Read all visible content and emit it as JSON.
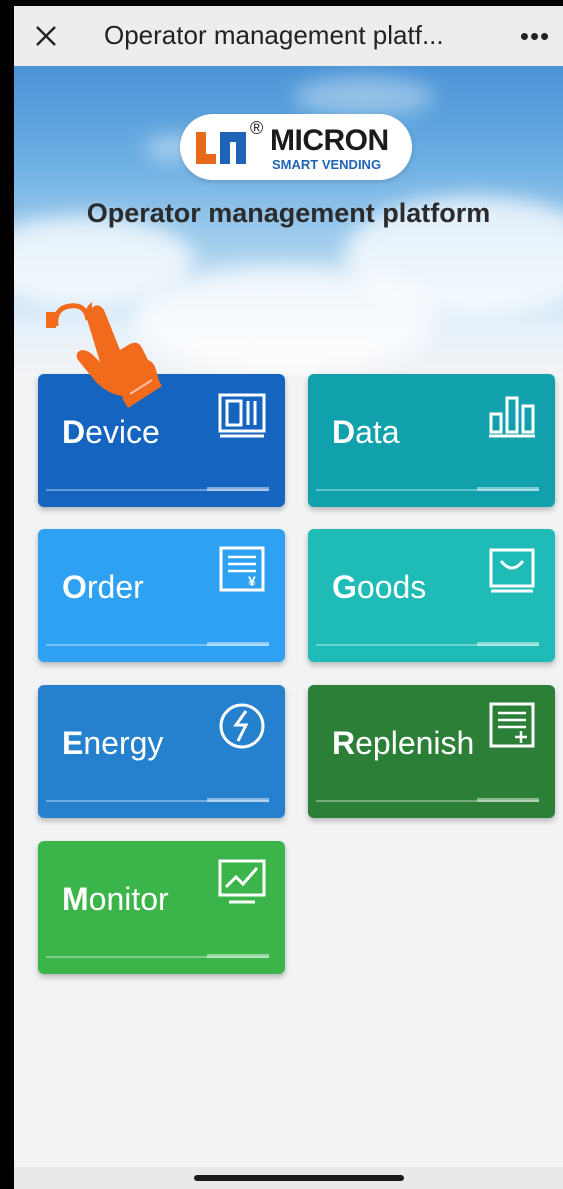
{
  "topbar": {
    "close_icon": "close-icon",
    "title": "Operator management platf...",
    "more_label": "•••"
  },
  "hero": {
    "logo": {
      "registered": "®",
      "name": "MICRON",
      "subtitle": "SMART VENDING"
    },
    "title": "Operator management platform"
  },
  "tiles": [
    {
      "first": "D",
      "rest": "evice",
      "icon": "device-panel-icon",
      "color": "#1565c0"
    },
    {
      "first": "D",
      "rest": "ata",
      "icon": "bar-chart-icon",
      "color": "#10a1ad"
    },
    {
      "first": "O",
      "rest": "rder",
      "icon": "receipt-icon",
      "color": "#2ea1f3"
    },
    {
      "first": "G",
      "rest": "oods",
      "icon": "bag-icon",
      "color": "#1fbcb7"
    },
    {
      "first": "E",
      "rest": "nergy",
      "icon": "energy-icon",
      "color": "#2580cd"
    },
    {
      "first": "R",
      "rest": "eplenish",
      "icon": "replenish-list-icon",
      "color": "#2b7f37"
    },
    {
      "first": "M",
      "rest": "onitor",
      "icon": "monitor-chart-icon",
      "color": "#3bb54a"
    }
  ]
}
